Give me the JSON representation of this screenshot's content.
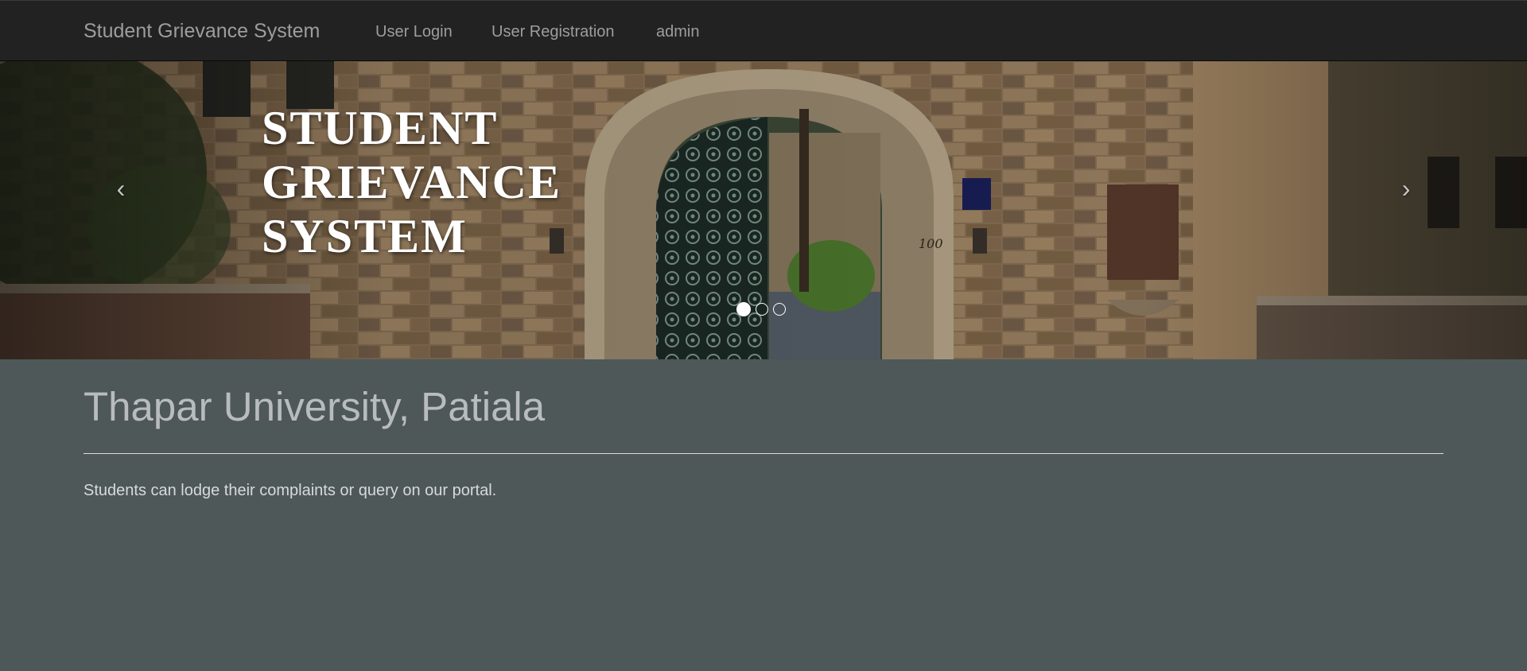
{
  "navbar": {
    "brand": "Student Grievance System",
    "links": [
      {
        "label": "User Login"
      },
      {
        "label": "User Registration"
      },
      {
        "label": "admin"
      }
    ]
  },
  "carousel": {
    "title_lines": [
      "STUDENT",
      "GRIEVANCE",
      "SYSTEM"
    ],
    "prev_icon": "‹",
    "next_icon": "›",
    "indicator_count": 3,
    "active_slide": 1,
    "arch_number": "100"
  },
  "main": {
    "heading": "Thapar University, Patiala",
    "tagline": "Students can lodge their complaints or query on our portal."
  },
  "colors": {
    "navbar_bg": "#222222",
    "nav_text": "#9d9d9d",
    "page_bg": "#4e5858",
    "heading": "#b9bcbc"
  }
}
